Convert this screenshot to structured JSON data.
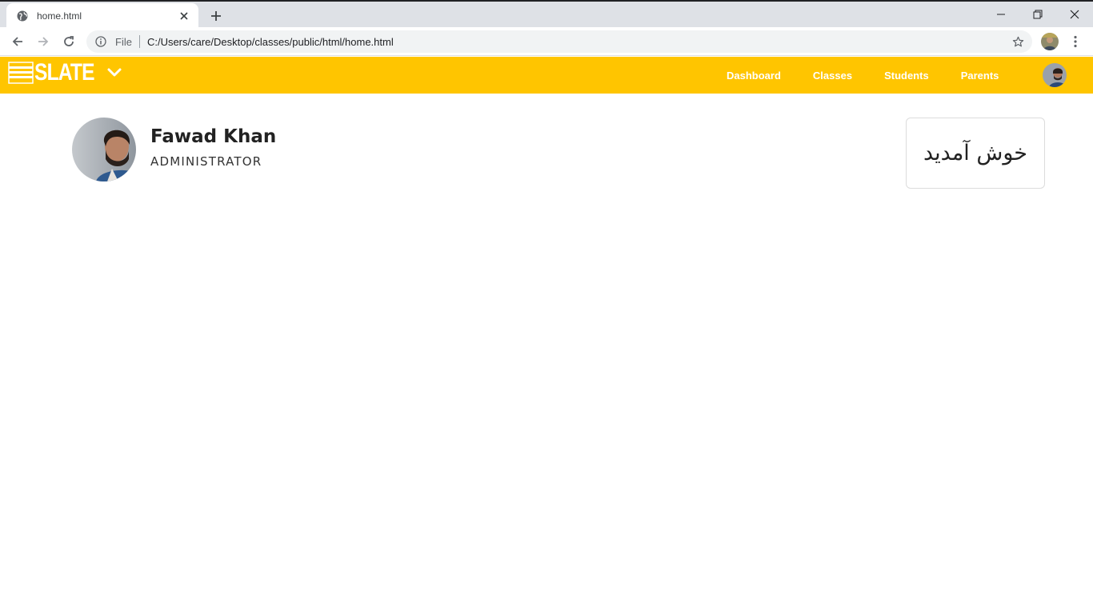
{
  "browser": {
    "tab": {
      "title": "home.html"
    },
    "address": {
      "scheme_label": "File",
      "url": "C:/Users/care/Desktop/classes/public/html/home.html"
    },
    "icons": {
      "favicon": "globe-icon",
      "close": "close-icon",
      "new_tab": "plus-icon",
      "back": "arrow-left-icon",
      "forward": "arrow-right-icon",
      "reload": "reload-icon",
      "info": "info-icon",
      "bookmark": "star-icon",
      "menu": "kebab-menu-icon"
    }
  },
  "app": {
    "brand": {
      "name": "SLATE",
      "color": "#ffc500"
    },
    "nav": {
      "items": [
        {
          "label": "Dashboard"
        },
        {
          "label": "Classes"
        },
        {
          "label": "Students"
        },
        {
          "label": "Parents"
        }
      ]
    }
  },
  "profile": {
    "name": "Fawad Khan",
    "role": "ADMINISTRATOR"
  },
  "welcome": {
    "text": "خوش آمدید"
  }
}
